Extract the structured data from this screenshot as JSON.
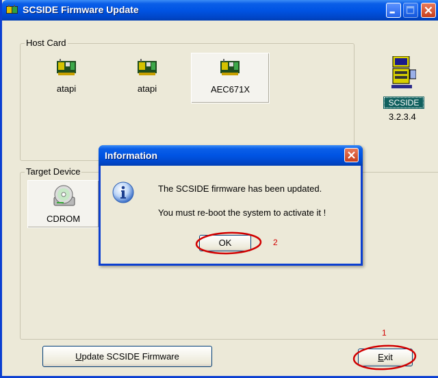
{
  "window": {
    "title": "SCSIDE Firmware Update"
  },
  "host_card": {
    "group_label": "Host Card",
    "cards": [
      {
        "label": "atapi",
        "icon": "expansion-card-icon"
      },
      {
        "label": "atapi",
        "icon": "expansion-card-icon"
      },
      {
        "label": "AEC671X",
        "icon": "expansion-card-icon",
        "selected": true
      }
    ]
  },
  "scside": {
    "label": "SCSIDE",
    "version": "3.2.3.4",
    "icon": "scside-computer-icon"
  },
  "target_device": {
    "group_label": "Target Device",
    "devices": [
      {
        "label": "CDROM",
        "icon": "cdrom-drive-icon",
        "selected": true
      }
    ]
  },
  "buttons": {
    "update_prefix": "U",
    "update_rest": "pdate SCSIDE Firmware",
    "exit_prefix": "E",
    "exit_rest": "xit"
  },
  "dialog": {
    "title": "Information",
    "line1": "The SCSIDE firmware has been updated.",
    "line2": "You must re-boot the system to activate it !",
    "ok_label": "OK",
    "icon": "information-icon"
  },
  "annotations": {
    "ok_marker": "2",
    "exit_marker": "1",
    "color": "#d10000"
  },
  "colors": {
    "titlebar": "#0054e3",
    "face": "#ece9d8",
    "scside_bg": "#10605e"
  }
}
